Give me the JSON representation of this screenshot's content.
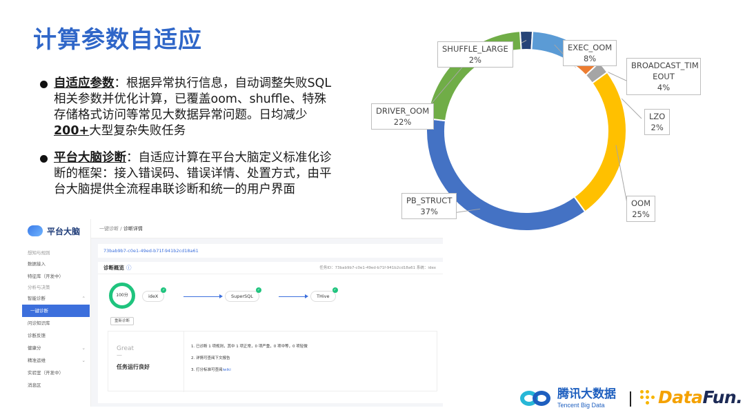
{
  "title": "计算参数自适应",
  "bullets": [
    {
      "key": "自适应参数",
      "text1": "：根据异常执行信息，自动调整失败SQL相关参数并优化计算，已覆盖oom、shuffle、特殊存储格式访问等常见大数据异常问题。日均减少",
      "highlight": "200+",
      "text2": "大型复杂失败任务"
    },
    {
      "key": "平台大脑诊断",
      "text1": "：自适应计算在平台大脑定义标准化诊断的框架：接入错误码、错误详情、处置方式，由平台大脑提供全流程串联诊断和统一的用户界面",
      "highlight": "",
      "text2": ""
    }
  ],
  "chart_data": {
    "type": "pie",
    "donut": true,
    "slices": [
      {
        "label": "SHUFFLE_LARGE",
        "value": 2,
        "display": "2%",
        "color": "#264478"
      },
      {
        "label": "EXEC_OOM",
        "value": 8,
        "display": "8%",
        "color": "#5b9bd5"
      },
      {
        "label": "BROADCAST_TIMEOUT",
        "label_lines": [
          "BROADCAST_TIM",
          "EOUT"
        ],
        "value": 4,
        "display": "4%",
        "color": "#ed7d31"
      },
      {
        "label": "LZO",
        "value": 2,
        "display": "2%",
        "color": "#a5a5a5"
      },
      {
        "label": "OOM",
        "value": 25,
        "display": "25%",
        "color": "#ffc000"
      },
      {
        "label": "PB_STRUCT",
        "value": 37,
        "display": "37%",
        "color": "#4472c4"
      },
      {
        "label": "DRIVER_OOM",
        "value": 22,
        "display": "22%",
        "color": "#70ad47"
      }
    ]
  },
  "app": {
    "logo_text": "平台大脑",
    "sidebar": [
      {
        "label": "想知与规则",
        "group": true
      },
      {
        "label": "数据接入"
      },
      {
        "label": "特征库（开发中）"
      },
      {
        "label": "分析与决策",
        "group": true
      },
      {
        "label": "智能诊断",
        "chevron": "⌃"
      },
      {
        "label": "一键诊断",
        "active": true
      },
      {
        "label": "问诊知识库"
      },
      {
        "label": "诊断反馈"
      },
      {
        "label": "健康分",
        "chevron": "⌄"
      },
      {
        "label": "精准运维",
        "chevron": "⌄"
      },
      {
        "label": "实验室（开发中）"
      },
      {
        "label": "消息区"
      }
    ],
    "breadcrumb_root": "一键诊断",
    "breadcrumb_sep": "/",
    "breadcrumb_current": "诊断详情",
    "task_id": "73bab9b7-c0e1-49ed-b71f-941b2cd18a61",
    "panel_title": "诊断概览",
    "info_icon": "ⓘ",
    "meta": "任务ID：73bab9b7-c0e1-49ed-b71f-941b2cd18a61    系统：idex",
    "score": "100分",
    "redo_label": "重新诊断",
    "flow": [
      "ideX",
      "SuperSQL",
      "THive"
    ],
    "great": "Great",
    "great_dash": "—",
    "status": "任务运行良好",
    "result_lines": [
      "1. 已诊断 1 项规则，其中 1 项正常，0 项严重，0 项中等，0 项轻微",
      "2. 详情可查阅下文报告"
    ],
    "result_line3_prefix": "3. 打分标准可查阅",
    "result_line3_link": "iwiki"
  },
  "footer": {
    "tbd_cn": "腾讯大数据",
    "tbd_en": "Tencent Big Data",
    "datafun_a": "Data",
    "datafun_b": "Fun."
  }
}
